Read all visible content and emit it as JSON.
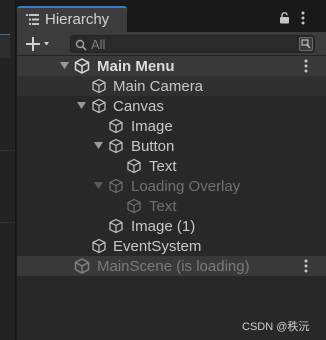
{
  "panel": {
    "tab_label": "Hierarchy"
  },
  "toolbar": {
    "add_label": "+▾",
    "search_placeholder": "All"
  },
  "tree": {
    "scene": {
      "label": "Main Menu"
    },
    "items": [
      {
        "label": "Main Camera"
      },
      {
        "label": "Canvas"
      },
      {
        "label": "Image"
      },
      {
        "label": "Button"
      },
      {
        "label": "Text"
      },
      {
        "label": "Loading Overlay"
      },
      {
        "label": "Text"
      },
      {
        "label": "Image (1)"
      },
      {
        "label": "EventSystem"
      }
    ],
    "loading_scene": {
      "label": "MainScene (is loading)"
    }
  },
  "watermark": "CSDN @秩沅"
}
